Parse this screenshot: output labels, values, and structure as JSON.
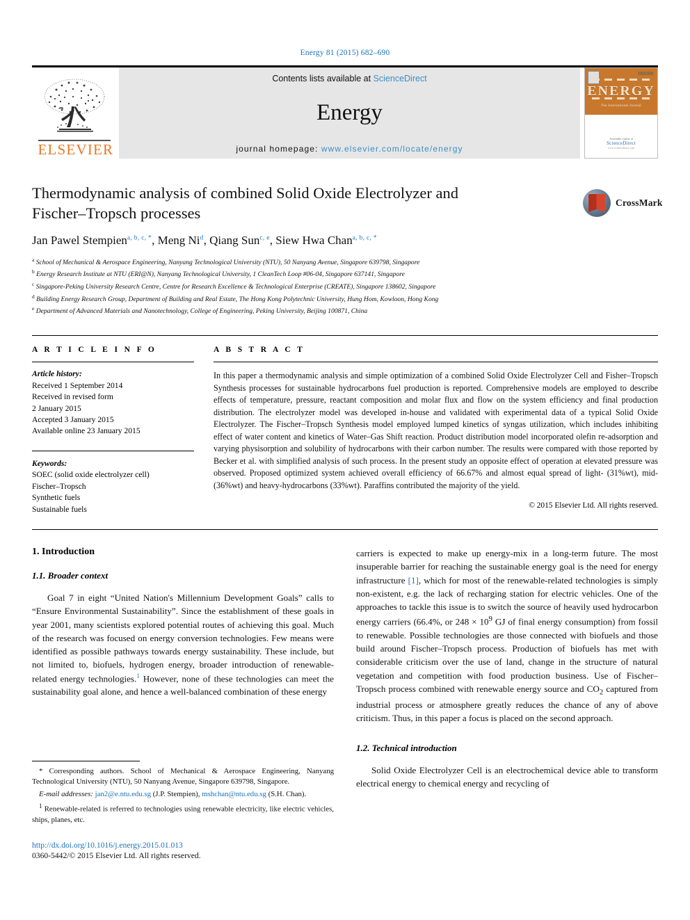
{
  "running_head": "Energy 81 (2015) 682–690",
  "masthead": {
    "publisher": "ELSEVIER",
    "contents_prefix": "Contents lists available at ",
    "contents_link": "ScienceDirect",
    "journal_title": "Energy",
    "homepage_prefix": "journal homepage: ",
    "homepage_link": "www.elsevier.com/locate/energy",
    "cover": {
      "title": "ENERGY",
      "subtitle": "The International Journal",
      "sd_label": "Available online at",
      "sd_brand": "ScienceDirect",
      "sd_url": "www.sciencedirect.com"
    }
  },
  "article": {
    "title": "Thermodynamic analysis of combined Solid Oxide Electrolyzer and Fischer–Tropsch processes",
    "authors": [
      {
        "name": "Jan Pawel Stempien",
        "sup": "a, b, c, *"
      },
      {
        "name": "Meng Ni",
        "sup": "d"
      },
      {
        "name": "Qiang Sun",
        "sup": "c, e"
      },
      {
        "name": "Siew Hwa Chan",
        "sup": "a, b, c, *"
      }
    ],
    "crossmark_label": "CrossMark",
    "affiliations": [
      {
        "mark": "a",
        "text": "School of Mechanical & Aerospace Engineering, Nanyang Technological University (NTU), 50 Nanyang Avenue, Singapore 639798, Singapore"
      },
      {
        "mark": "b",
        "text": "Energy Research Institute at NTU (ERI@N), Nanyang Technological University, 1 CleanTech Loop #06-04, Singapore 637141, Singapore"
      },
      {
        "mark": "c",
        "text": "Singapore-Peking University Research Centre, Centre for Research Excellence & Technological Enterprise (CREATE), Singapore 138602, Singapore"
      },
      {
        "mark": "d",
        "text": "Building Energy Research Group, Department of Building and Real Estate, The Hong Kong Polytechnic University, Hung Hom, Kowloon, Hong Kong"
      },
      {
        "mark": "e",
        "text": "Department of Advanced Materials and Nanotechnology, College of Engineering, Peking University, Beijing 100871, China"
      }
    ]
  },
  "article_info": {
    "heading": "A R T I C L E   I N F O",
    "history_label": "Article history:",
    "history": [
      "Received 1 September 2014",
      "Received in revised form",
      "2 January 2015",
      "Accepted 3 January 2015",
      "Available online 23 January 2015"
    ],
    "keywords_label": "Keywords:",
    "keywords": [
      "SOEC (solid oxide electrolyzer cell)",
      "Fischer–Tropsch",
      "Synthetic fuels",
      "Sustainable fuels"
    ]
  },
  "abstract": {
    "heading": "A B S T R A C T",
    "text": "In this paper a thermodynamic analysis and simple optimization of a combined Solid Oxide Electrolyzer Cell and Fisher–Tropsch Synthesis processes for sustainable hydrocarbons fuel production is reported. Comprehensive models are employed to describe effects of temperature, pressure, reactant composition and molar flux and flow on the system efficiency and final production distribution. The electrolyzer model was developed in-house and validated with experimental data of a typical Solid Oxide Electrolyzer. The Fischer–Tropsch Synthesis model employed lumped kinetics of syngas utilization, which includes inhibiting effect of water content and kinetics of Water–Gas Shift reaction. Product distribution model incorporated olefin re-adsorption and varying physisorption and solubility of hydrocarbons with their carbon number. The results were compared with those reported by Becker et al. with simplified analysis of such process. In the present study an opposite effect of operation at elevated pressure was observed. Proposed optimized system achieved overall efficiency of 66.67% and almost equal spread of light- (31%wt), mid-(36%wt) and heavy-hydrocarbons (33%wt). Paraffins contributed the majority of the yield.",
    "copyright": "© 2015 Elsevier Ltd. All rights reserved."
  },
  "body": {
    "section1_title": "1.  Introduction",
    "section11_title": "1.1.  Broader context",
    "para_left_1_a": "Goal 7 in eight “United Nation's Millennium Development Goals” calls to “Ensure Environmental Sustainability”. Since the establishment of these goals in year 2001, many scientists explored potential routes of achieving this goal. Much of the research was focused on energy conversion technologies. Few means were identified as possible pathways towards energy sustainability. These include, but not limited to, biofuels, hydrogen energy, broader introduction of renewable-related energy technologies.",
    "para_left_1_sup": "1",
    "para_left_1_b": " However, none of these technologies can meet the sustainability goal alone, and hence a well-balanced combination of these energy",
    "para_right_1_a": "carriers is expected to make up energy-mix in a long-term future. The most insuperable barrier for reaching the sustainable energy goal is the need for energy infrastructure ",
    "para_right_1_ref": "[1]",
    "para_right_1_b": ", which for most of the renewable-related technologies is simply non-existent, e.g. the lack of recharging station for electric vehicles. One of the approaches to tackle this issue is to switch the source of heavily used hydrocarbon energy carriers (66.4%, or 248 × 10",
    "para_right_1_exp": "9",
    "para_right_1_c": " GJ of final energy consumption) from fossil to renewable. Possible technologies are those connected with biofuels and those build around Fischer–Tropsch process. Production of biofuels has met with considerable criticism over the use of land, change in the structure of natural vegetation and competition with food production business. Use of Fischer–Tropsch process combined with renewable energy source and CO",
    "para_right_1_sub": "2",
    "para_right_1_d": " captured from industrial process or atmosphere greatly reduces the chance of any of above criticism. Thus, in this paper a focus is placed on the second approach.",
    "section12_title": "1.2.  Technical introduction",
    "para_right_2": "Solid Oxide Electrolyzer Cell is an electrochemical device able to transform electrical energy to chemical energy and recycling of"
  },
  "footnotes": {
    "corresponding_marker": "*",
    "corresponding": " Corresponding authors. School of Mechanical & Aerospace Engineering, Nanyang Technological University (NTU), 50 Nanyang Avenue, Singapore 639798, Singapore.",
    "email_label": "E-mail addresses:",
    "email_1": "jan2@e.ntu.edu.sg",
    "email_1_owner": " (J.P. Stempien), ",
    "email_2": "mshchan@ntu.edu.sg",
    "email_2_owner": " (S.H. Chan).",
    "note_marker": "1",
    "note_text": " Renewable-related is referred to technologies using renewable electricity, like electric vehicles, ships, planes, etc."
  },
  "footer": {
    "doi": "http://dx.doi.org/10.1016/j.energy.2015.01.013",
    "issn": "0360-5442/© 2015 Elsevier Ltd. All rights reserved."
  }
}
